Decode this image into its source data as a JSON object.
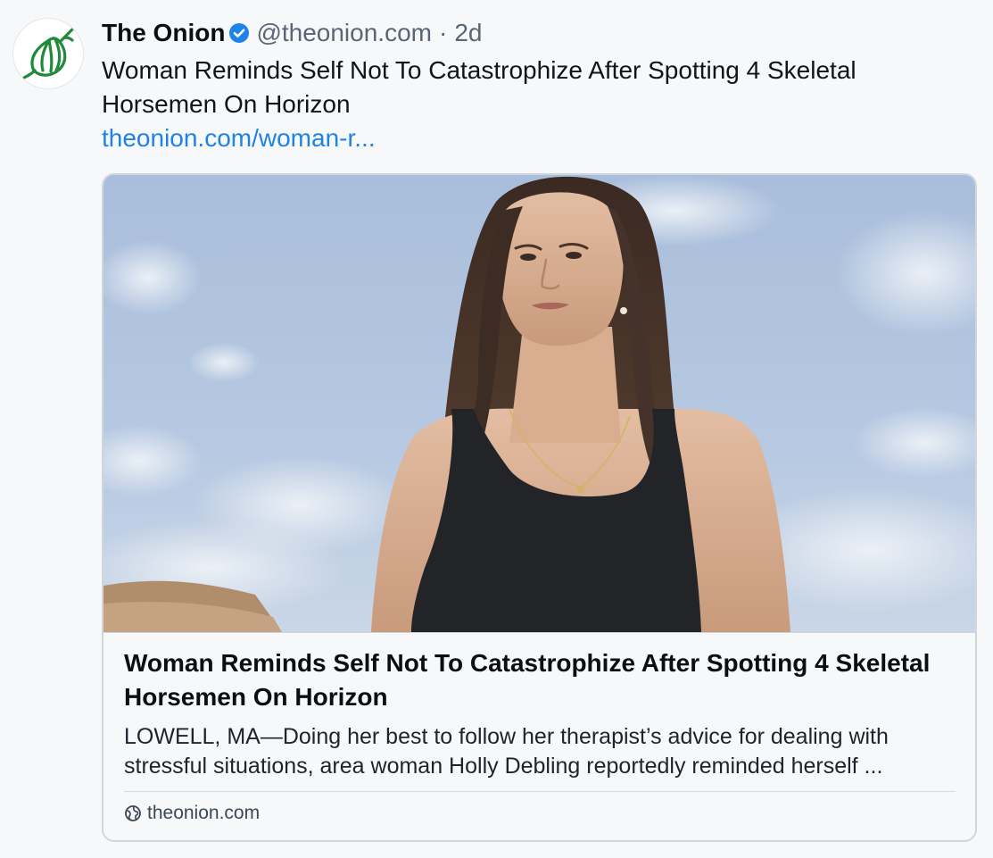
{
  "post": {
    "author": {
      "display_name": "The Onion",
      "handle": "@theonion.com",
      "verified": true,
      "avatar_icon": "onion-logo-icon"
    },
    "separator": "·",
    "age": "2d",
    "text": "Woman Reminds Self Not To Catastrophize After Spotting 4 Skeletal Horsemen On Horizon",
    "link_text": "theonion.com/woman-r..."
  },
  "card": {
    "image_icon": "article-photo",
    "title": "Woman Reminds Self Not To Catastrophize After Spotting 4 Skeletal Horsemen On Horizon",
    "description": "LOWELL, MA—Doing her best to follow her therapist’s advice for dealing with stressful situations, area woman Holly Debling reportedly reminded herself ...",
    "domain": "theonion.com",
    "domain_icon": "globe-icon"
  },
  "colors": {
    "link": "#1d83e6",
    "verified_badge": "#1d83e6",
    "onion_logo": "#1f8a3a",
    "background": "#f7f8fa",
    "card_border": "#cfd6de"
  }
}
